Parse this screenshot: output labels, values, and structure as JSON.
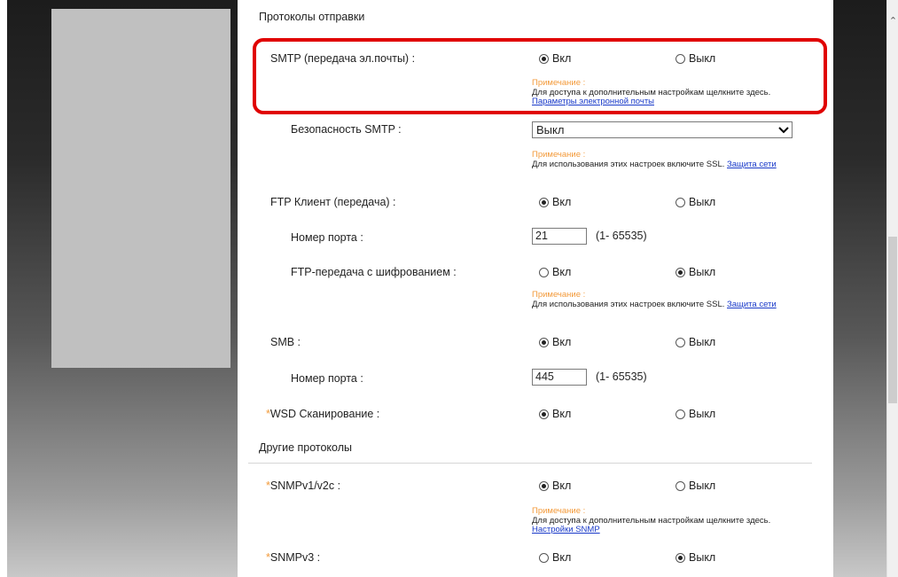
{
  "sections": {
    "send_protocols": "Протоколы отправки",
    "other_protocols": "Другие протоколы"
  },
  "common": {
    "on": "Вкл",
    "off": "Выкл",
    "required_mark": "*",
    "note_head": "Примечание :"
  },
  "smtp": {
    "label": "SMTP (передача эл.почты) :",
    "selected": "on",
    "note_text": "Для доступа к дополнительным настройкам щелкните здесь.",
    "note_link": "Параметры электронной почты"
  },
  "smtp_security": {
    "label": "Безопасность SMTP :",
    "value": "Выкл",
    "note_text": "Для использования этих настроек включите SSL.",
    "note_link": "Защита сети"
  },
  "ftp_client": {
    "label": "FTP Клиент (передача) :",
    "selected": "on"
  },
  "ftp_port": {
    "label": "Номер порта :",
    "value": "21",
    "range": "(1- 65535)"
  },
  "ftp_encrypted": {
    "label": "FTP-передача с шифрованием :",
    "selected": "off",
    "note_text": "Для использования этих настроек включите SSL.",
    "note_link": "Защита сети"
  },
  "smb": {
    "label": "SMB :",
    "selected": "on"
  },
  "smb_port": {
    "label": "Номер порта :",
    "value": "445",
    "range": "(1- 65535)"
  },
  "wsd_scan": {
    "label": "WSD Сканирование :",
    "selected": "on"
  },
  "snmpv1": {
    "label": "SNMPv1/v2c :",
    "selected": "on",
    "note_text": "Для доступа к дополнительным настройкам щелкните здесь.",
    "note_link": "Настройки SNMP"
  },
  "snmpv3": {
    "label": "SNMPv3 :",
    "selected": "off"
  },
  "colors": {
    "highlight": "#e00000",
    "note_head": "#f39a3a",
    "link": "#1a3ac9"
  }
}
